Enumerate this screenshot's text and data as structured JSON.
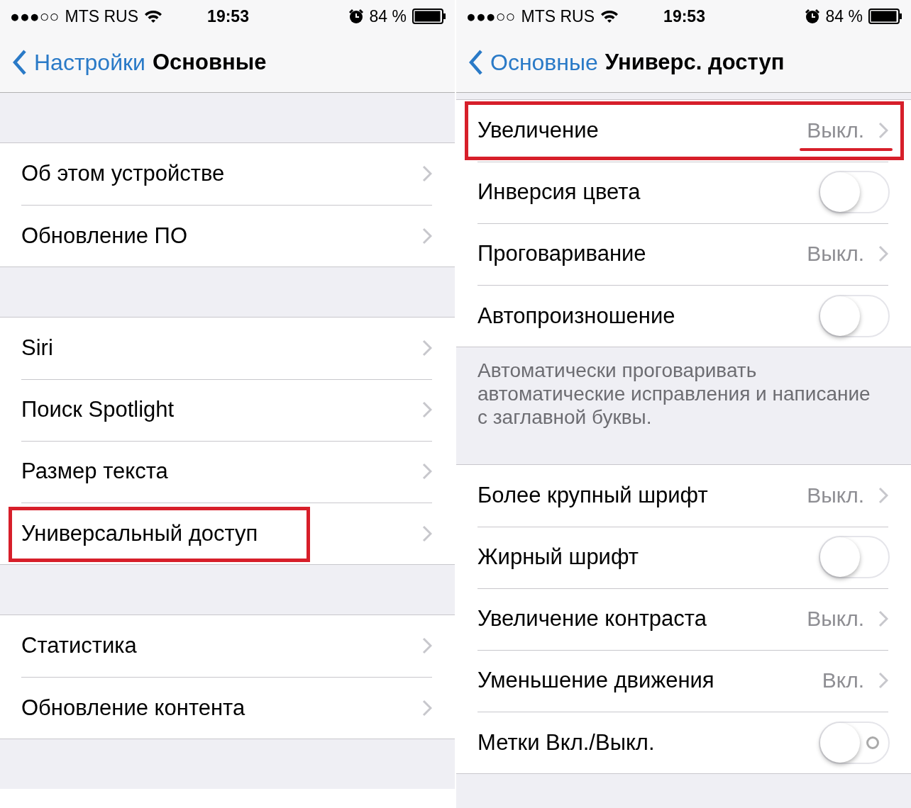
{
  "panels": [
    {
      "status_bar": {
        "signal": "●●●○○",
        "carrier": "MTS RUS",
        "time": "19:53",
        "battery": "84 %"
      },
      "nav": {
        "back": "Настройки",
        "title": "Основные"
      },
      "blocks": [
        {
          "kind": "spacer"
        },
        {
          "kind": "group",
          "rows": [
            {
              "kind": "link",
              "label": "Об этом устройстве",
              "label_framed": false,
              "row_framed": false,
              "value_underlined": false
            },
            {
              "kind": "link",
              "label": "Обновление ПО",
              "label_framed": false,
              "row_framed": false,
              "value_underlined": false
            }
          ]
        },
        {
          "kind": "spacer"
        },
        {
          "kind": "group",
          "rows": [
            {
              "kind": "link",
              "label": "Siri",
              "label_framed": false,
              "row_framed": false,
              "value_underlined": false
            },
            {
              "kind": "link",
              "label": "Поиск Spotlight",
              "label_framed": false,
              "row_framed": false,
              "value_underlined": false
            },
            {
              "kind": "link",
              "label": "Размер текста",
              "label_framed": false,
              "row_framed": false,
              "value_underlined": false
            },
            {
              "kind": "link",
              "label": "Универсальный доступ",
              "label_framed": true,
              "row_framed": false,
              "value_underlined": false
            }
          ]
        },
        {
          "kind": "spacer"
        },
        {
          "kind": "group",
          "rows": [
            {
              "kind": "link",
              "label": "Статистика",
              "label_framed": false,
              "row_framed": false,
              "value_underlined": false
            },
            {
              "kind": "link",
              "label": "Обновление контента",
              "label_framed": false,
              "row_framed": false,
              "value_underlined": false
            }
          ]
        },
        {
          "kind": "spacer"
        }
      ]
    },
    {
      "status_bar": {
        "signal": "●●●○○",
        "carrier": "MTS RUS",
        "time": "19:53",
        "battery": "84 %"
      },
      "nav": {
        "back": "Основные",
        "title": "Универс. доступ"
      },
      "blocks": [
        {
          "kind": "thin"
        },
        {
          "kind": "group",
          "rows": [
            {
              "kind": "link",
              "label": "Увеличение",
              "value": "Выкл.",
              "label_framed": false,
              "row_framed": true,
              "value_underlined": true
            },
            {
              "kind": "toggle",
              "label": "Инверсия цвета",
              "on": false,
              "label_framed": false,
              "row_framed": false,
              "value_underlined": false
            },
            {
              "kind": "link",
              "label": "Проговаривание",
              "value": "Выкл.",
              "label_framed": false,
              "row_framed": false,
              "value_underlined": false
            },
            {
              "kind": "toggle",
              "label": "Автопроизношение",
              "on": false,
              "label_framed": false,
              "row_framed": false,
              "value_underlined": false
            }
          ]
        },
        {
          "kind": "note",
          "text": "Автоматически проговаривать автоматические исправления и написание с заглавной буквы."
        },
        {
          "kind": "group",
          "rows": [
            {
              "kind": "link",
              "label": "Более крупный шрифт",
              "value": "Выкл.",
              "label_framed": false,
              "row_framed": false,
              "value_underlined": false
            },
            {
              "kind": "toggle",
              "label": "Жирный шрифт",
              "on": false,
              "label_framed": false,
              "row_framed": false,
              "value_underlined": false
            },
            {
              "kind": "link",
              "label": "Увеличение контраста",
              "value": "Выкл.",
              "label_framed": false,
              "row_framed": false,
              "value_underlined": false
            },
            {
              "kind": "link",
              "label": "Уменьшение движения",
              "value": "Вкл.",
              "label_framed": false,
              "row_framed": false,
              "value_underlined": false
            },
            {
              "kind": "toggle-labeled",
              "label": "Метки Вкл./Выкл.",
              "on": false,
              "label_framed": false,
              "row_framed": false,
              "value_underlined": false
            }
          ]
        },
        {
          "kind": "spacer"
        }
      ]
    }
  ]
}
